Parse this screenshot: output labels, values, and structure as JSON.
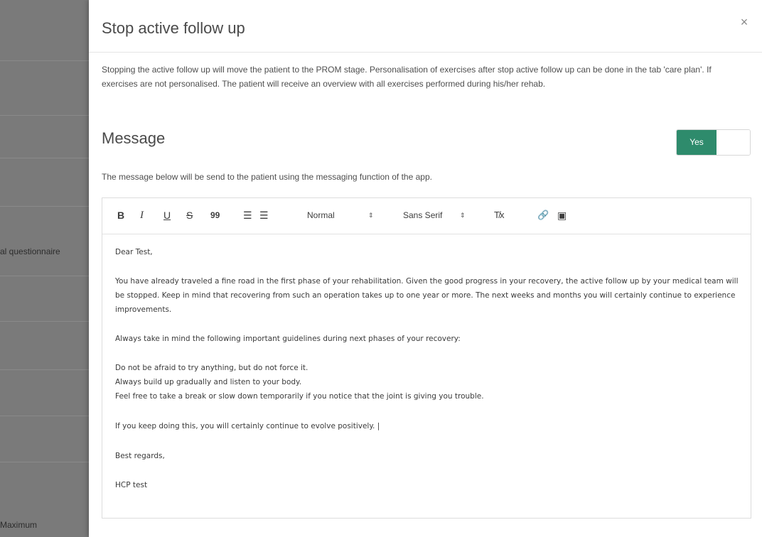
{
  "background": {
    "labels": [
      "al questionnaire",
      "Maximum"
    ]
  },
  "modal": {
    "title": "Stop active follow up",
    "close_symbol": "×",
    "intro": "Stopping the active follow up will move the patient to the PROM stage. Personalisation of exercises after stop active follow up can be done in the tab 'care plan'. If exercises are not personalised. The patient will receive an overview with all exercises performed during his/her rehab.",
    "message_heading": "Message",
    "toggle_label": "Yes",
    "toggle_on": true,
    "helper_text": "The message below will be send to the patient using the messaging function of the app.",
    "accent_color": "#2e8b6c"
  },
  "toolbar": {
    "bold": "B",
    "italic": "I",
    "underline": "U",
    "strike": "S",
    "quote": "99",
    "ordered_list": "☰",
    "bullet_list": "☰",
    "size_value": "Normal",
    "font_value": "Sans Serif",
    "caret": "⇕",
    "clear_format": "T̸x",
    "link": "🔗",
    "image": "▣"
  },
  "message": {
    "greeting": "Dear Test,",
    "para1": "You have already traveled a fine road in the first phase of your rehabilitation. Given the good progress in your recovery, the active follow up by your medical team will be stopped. Keep in mind that recovering from such an operation takes up to one year or more. The next weeks and months you will certainly continue to experience improvements.",
    "para2": "Always take in mind the following important guidelines during next phases of your recovery:",
    "guideline1": "Do not be afraid to try anything, but do not force it.",
    "guideline2": "Always build up gradually and listen to your body.",
    "guideline3": "Feel free to take a break or slow down temporarily if you notice that the joint is giving you trouble.",
    "para3": "If you keep doing this, you will certainly continue to evolve positively. |",
    "closing": "Best regards,",
    "signature": "HCP test"
  }
}
